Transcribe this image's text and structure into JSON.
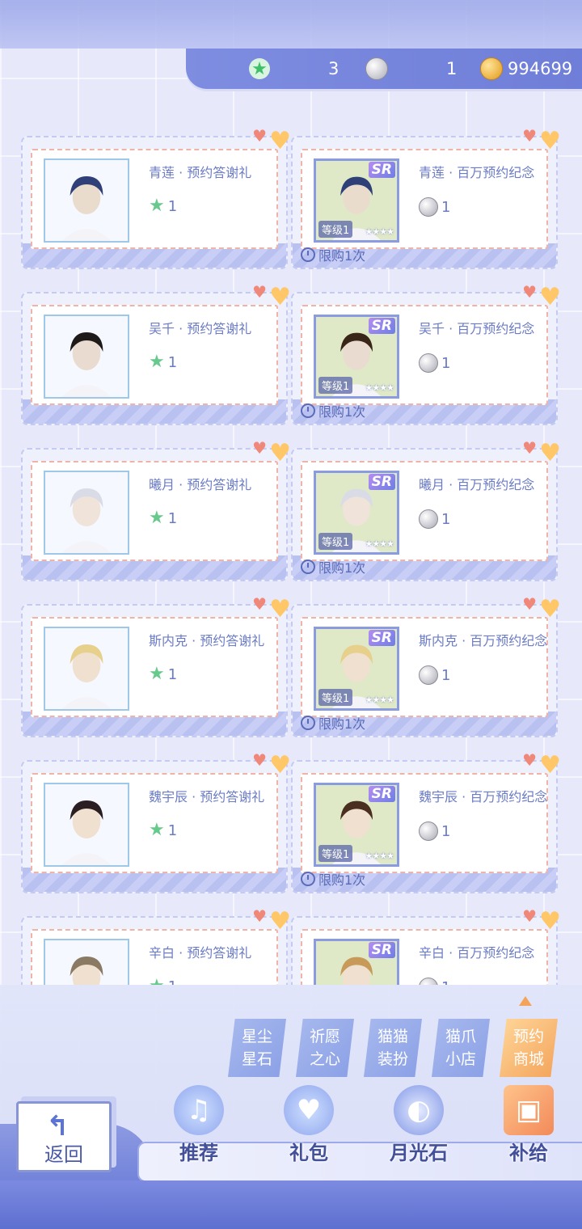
{
  "currency": {
    "star_dust": "3",
    "silver": "1",
    "gold": "994699"
  },
  "items": [
    {
      "name": "青莲 · 预约答谢礼",
      "price": "1",
      "currency": "star",
      "sr": false,
      "level": "",
      "limit": ""
    },
    {
      "name": "青莲 · 百万预约纪念",
      "price": "1",
      "currency": "silver",
      "sr": true,
      "level": "等级1",
      "limit": "限购1次"
    },
    {
      "name": "吴千 · 预约答谢礼",
      "price": "1",
      "currency": "star",
      "sr": false,
      "level": "",
      "limit": ""
    },
    {
      "name": "吴千 · 百万预约纪念",
      "price": "1",
      "currency": "silver",
      "sr": true,
      "level": "等级1",
      "limit": "限购1次"
    },
    {
      "name": "曦月 · 预约答谢礼",
      "price": "1",
      "currency": "star",
      "sr": false,
      "level": "",
      "limit": ""
    },
    {
      "name": "曦月 · 百万预约纪念",
      "price": "1",
      "currency": "silver",
      "sr": true,
      "level": "等级1",
      "limit": "限购1次"
    },
    {
      "name": "斯内克 · 预约答谢礼",
      "price": "1",
      "currency": "star",
      "sr": false,
      "level": "",
      "limit": ""
    },
    {
      "name": "斯内克 · 百万预约纪念",
      "price": "1",
      "currency": "silver",
      "sr": true,
      "level": "等级1",
      "limit": "限购1次"
    },
    {
      "name": "魏宇辰 · 预约答谢礼",
      "price": "1",
      "currency": "star",
      "sr": false,
      "level": "",
      "limit": ""
    },
    {
      "name": "魏宇辰 · 百万预约纪念",
      "price": "1",
      "currency": "silver",
      "sr": true,
      "level": "等级1",
      "limit": "限购1次"
    },
    {
      "name": "辛白 · 预约答谢礼",
      "price": "1",
      "currency": "star",
      "sr": false,
      "level": "",
      "limit": ""
    },
    {
      "name": "辛白 · 百万预约纪念",
      "price": "1",
      "currency": "silver",
      "sr": true,
      "level": "",
      "limit": ""
    }
  ],
  "sr_label": "SR",
  "categories": [
    {
      "line1": "星尘",
      "line2": "星石",
      "active": false
    },
    {
      "line1": "祈愿",
      "line2": "之心",
      "active": false
    },
    {
      "line1": "猫猫",
      "line2": "装扮",
      "active": false
    },
    {
      "line1": "猫爪",
      "line2": "小店",
      "active": false
    },
    {
      "line1": "预约",
      "line2": "商城",
      "active": true
    }
  ],
  "nav": [
    {
      "label": "推荐",
      "icon": "swan-icon"
    },
    {
      "label": "礼包",
      "icon": "gift-heart-icon"
    },
    {
      "label": "月光石",
      "icon": "moonstone-icon"
    },
    {
      "label": "补给",
      "icon": "shopping-bag-icon"
    }
  ],
  "back_label": "返回",
  "colors": {
    "accent": "#6f7ed8",
    "active_tab": "#f3a35a",
    "text": "#6b7cc4"
  }
}
